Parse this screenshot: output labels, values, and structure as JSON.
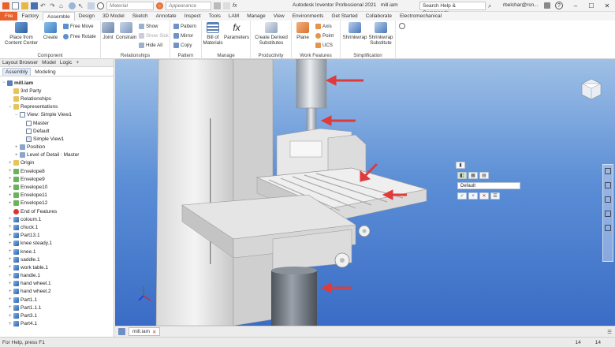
{
  "app": {
    "title": "Autodesk Inventor Professional 2021",
    "document": "mill.iam",
    "search_placeholder": "Search Help & Commands...",
    "user": "rbelchar@rsn...",
    "material_combo": "Material",
    "appearance_combo": "Appearance"
  },
  "tabs": [
    "File",
    "Factory",
    "Assemble",
    "Design",
    "3D Model",
    "Sketch",
    "Annotate",
    "Inspect",
    "Tools",
    "LAM",
    "Manage",
    "View",
    "Environments",
    "Get Started",
    "Collaborate",
    "Electromechanical"
  ],
  "active_tab": "Assemble",
  "ribbon": {
    "component": {
      "label": "Component",
      "place": "Place from Content Center",
      "create": "Create",
      "free_move": "Free Move",
      "free_rotate": "Free Rotate"
    },
    "relationships": {
      "label": "Relationships",
      "joint": "Joint",
      "constrain": "Constrain",
      "show": "Show",
      "show_sick": "Show Sick",
      "hide_all": "Hide All"
    },
    "pattern": {
      "label": "Pattern",
      "pattern": "Pattern",
      "mirror": "Mirror",
      "copy": "Copy"
    },
    "manage": {
      "label": "Manage",
      "bom": "Bill of Materials",
      "parameters": "Parameters"
    },
    "productivity": {
      "label": "Productivity",
      "create_derived": "Create Derived Substitutes"
    },
    "work_features": {
      "label": "Work Features",
      "plane": "Plane",
      "axis": "Axis",
      "point": "Point",
      "ucs": "UCS"
    },
    "simplification": {
      "label": "Simplification",
      "shrinkwrap": "Shrinkwrap",
      "shrinkwrap_sub": "Shrinkwrap Substitute"
    }
  },
  "browser": {
    "header": [
      "Layout Browser",
      "Model",
      "Logic",
      "+"
    ],
    "subtabs": [
      "Assembly",
      "Modeling"
    ],
    "tree": [
      {
        "label": "mill.iam",
        "indent": 0,
        "icon": "assembly-icon",
        "exp": "−"
      },
      {
        "label": "3rd Party",
        "indent": 1,
        "icon": "folder-icon",
        "exp": ""
      },
      {
        "label": "Relationships",
        "indent": 1,
        "icon": "folder-icon",
        "exp": ""
      },
      {
        "label": "Representations",
        "indent": 1,
        "icon": "folder-icon",
        "exp": "−"
      },
      {
        "label": "View: Simple View1",
        "indent": 2,
        "icon": "view-icon",
        "exp": "−"
      },
      {
        "label": "Master",
        "indent": 3,
        "icon": "view-icon",
        "exp": ""
      },
      {
        "label": "Default",
        "indent": 3,
        "icon": "view-icon",
        "exp": ""
      },
      {
        "label": "Simple View1",
        "indent": 3,
        "icon": "check-icon",
        "exp": ""
      },
      {
        "label": "Position",
        "indent": 2,
        "icon": "position-icon",
        "exp": "+"
      },
      {
        "label": "Level of Detail : Master",
        "indent": 2,
        "icon": "lod-icon",
        "exp": "+"
      },
      {
        "label": "Origin",
        "indent": 1,
        "icon": "folder-icon",
        "exp": "+"
      },
      {
        "label": "Envelope8",
        "indent": 1,
        "icon": "envelope-icon",
        "exp": "+"
      },
      {
        "label": "Envelope9",
        "indent": 1,
        "icon": "envelope-icon",
        "exp": "+"
      },
      {
        "label": "Envelope10",
        "indent": 1,
        "icon": "envelope-icon",
        "exp": "+"
      },
      {
        "label": "Envelope11",
        "indent": 1,
        "icon": "envelope-icon",
        "exp": "+"
      },
      {
        "label": "Envelope12",
        "indent": 1,
        "icon": "envelope-icon",
        "exp": "+"
      },
      {
        "label": "End of Features",
        "indent": 1,
        "icon": "end-icon",
        "exp": ""
      },
      {
        "label": "coloum.1",
        "indent": 1,
        "icon": "part-icon",
        "exp": "+"
      },
      {
        "label": "chuck.1",
        "indent": 1,
        "icon": "part-icon",
        "exp": "+"
      },
      {
        "label": "Part13.1",
        "indent": 1,
        "icon": "part-icon",
        "exp": "+"
      },
      {
        "label": "knee steady.1",
        "indent": 1,
        "icon": "part-icon",
        "exp": "+"
      },
      {
        "label": "knee.1",
        "indent": 1,
        "icon": "part-icon",
        "exp": "+"
      },
      {
        "label": "saddle.1",
        "indent": 1,
        "icon": "part-icon",
        "exp": "+"
      },
      {
        "label": "work table.1",
        "indent": 1,
        "icon": "part-icon",
        "exp": "+"
      },
      {
        "label": "handle.1",
        "indent": 1,
        "icon": "part-icon",
        "exp": "+"
      },
      {
        "label": "hand wheel.1",
        "indent": 1,
        "icon": "part-icon",
        "exp": "+"
      },
      {
        "label": "hand wheel.2",
        "indent": 1,
        "icon": "part-icon",
        "exp": "+"
      },
      {
        "label": "Part1.1",
        "indent": 1,
        "icon": "part-icon",
        "exp": "+"
      },
      {
        "label": "Part1.1.1",
        "indent": 1,
        "icon": "part-icon",
        "exp": "+"
      },
      {
        "label": "Part3.1",
        "indent": 1,
        "icon": "part-icon",
        "exp": "+"
      },
      {
        "label": "Part4.1",
        "indent": 1,
        "icon": "part-icon",
        "exp": "+"
      }
    ]
  },
  "minitoolbar": {
    "combo": "Default"
  },
  "doc_tab": "mill.iam",
  "status": {
    "help": "For Help, press F1",
    "count1": "14",
    "count2": "14"
  },
  "colors": {
    "accent": "#e8612c",
    "arrow": "#e03a3a",
    "viewport_top": "#9fc0e6",
    "viewport_bottom": "#3a6cc6"
  }
}
